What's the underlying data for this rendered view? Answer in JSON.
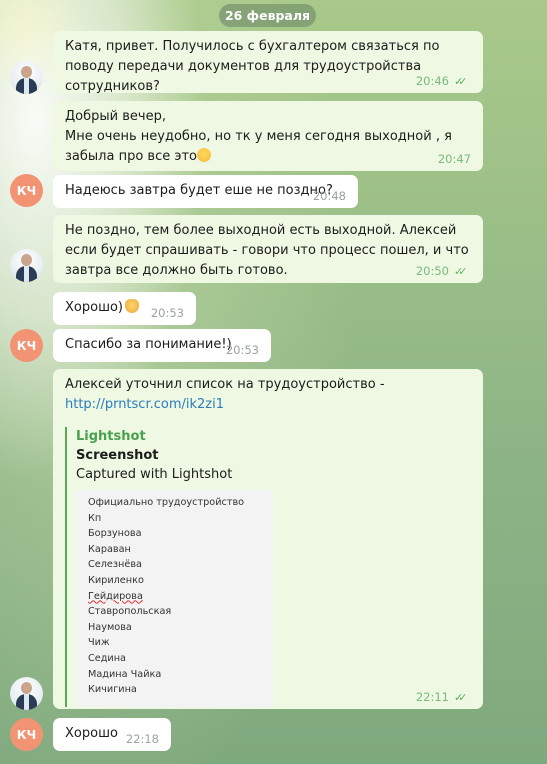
{
  "date_label": "26 февраля",
  "messages": [
    {
      "text": "Катя, привет. Получилось с бухгалтером связаться по поводу передачи документов для трудоустройства сотрудников?",
      "time": "20:46"
    },
    {
      "text": "Добрый вечер,\nМне очень неудобно, но тк у меня сегодня выходной , я забыла про все это",
      "time": "20:47"
    },
    {
      "text": "Надеюсь завтра будет еше не поздно?",
      "time": "20:48"
    },
    {
      "text": "Не поздно, тем более выходной есть выходной. Алексей если будет спрашивать - говори что процесс пошел, и что завтра все должно быть готово.",
      "time": "20:50"
    },
    {
      "text": "Хорошо)",
      "time": "20:53"
    },
    {
      "text": "Спасибо за понимание!)",
      "time": "20:53"
    },
    {
      "text": "Алексей уточнил список на трудоустройство -",
      "link": "http://prntscr.com/ik2zi1",
      "time": "22:11"
    },
    {
      "text": "Хорошо",
      "time": "22:18"
    }
  ],
  "link_preview": {
    "site": "Lightshot",
    "title": "Screenshot",
    "description": "Captured with Lightshot",
    "image_lines": [
      "Официально трудоустройство",
      "Кп",
      "Борзунова",
      "Караван",
      "Селезнёва",
      "Кириленко",
      "Гейдирова",
      "Ставропольская",
      "Наумова",
      "Чиж",
      "Седина",
      "Мадина Чайка",
      "Кичигина"
    ]
  },
  "avatar_initials": "КЧ",
  "emoji": [
    "worried-face-emoji",
    "ok-hand-emoji"
  ],
  "colors": {
    "incoming": "#ffffff",
    "outgoing": "#eef8e3",
    "link": "#2a7ebd",
    "avatar": "#f29374",
    "read_ticks": "#5fb35f"
  }
}
